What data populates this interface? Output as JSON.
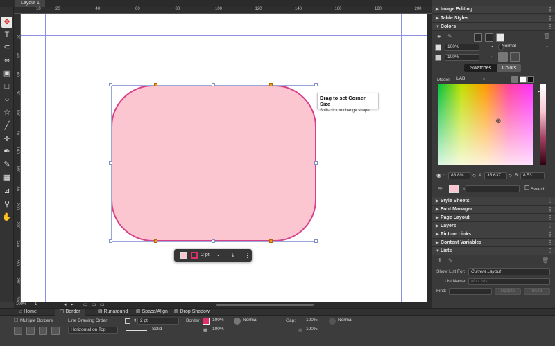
{
  "document": {
    "tab_label": "Layout 1"
  },
  "ruler": {
    "h_labels": [
      "10",
      "20",
      "40",
      "60",
      "80",
      "100",
      "120",
      "140",
      "160",
      "180",
      "200",
      "22"
    ],
    "v_labels": [
      "20",
      "40",
      "60",
      "80",
      "100",
      "120",
      "140",
      "160",
      "180",
      "200",
      "220",
      "240",
      "260",
      "280",
      "300"
    ]
  },
  "tools": [
    "move-icon",
    "text-icon",
    "text-link-icon",
    "link-icon",
    "picture-icon",
    "rectangle-icon",
    "oval-icon",
    "star-icon",
    "line-icon",
    "crosshair-icon",
    "pen-icon",
    "pencil-icon",
    "table-icon",
    "eyedropper-icon",
    "zoom-icon",
    "hand-icon"
  ],
  "tooltip": {
    "title": "Drag to set Corner Size",
    "subtitle": "Shift-click to change shape"
  },
  "floatbar": {
    "width": "2 pt"
  },
  "statusbar": {
    "zoom": "100%",
    "page": "1"
  },
  "panel": {
    "sections_top": [
      "Image Editing",
      "Table Styles",
      "Colors"
    ],
    "colors": {
      "opacity1": "100%",
      "blend": "Normal",
      "opacity2": "100%",
      "tab_swatches": "Swatches",
      "tab_colors": "Colors",
      "model_label": "Model:",
      "model_value": "LAB",
      "l_label": "L:",
      "l_value": "88.8%",
      "a_label": "A:",
      "a_value": "35.637",
      "b_label": "B:",
      "b_value": "8.531",
      "hash": "#",
      "swatch_label": "Swatch",
      "current_color": "#fcc6d1"
    },
    "sections_bottom": [
      "Style Sheets",
      "Font Manager",
      "Page Layout",
      "Layers",
      "Picture Links",
      "Content Variables",
      "Lists"
    ],
    "lists": {
      "show_list_label": "Show List For:",
      "show_list_value": "Current Layout",
      "list_name_label": "List Name:",
      "list_name_value": "No Lists",
      "find_label": "Find:",
      "update_label": "Update",
      "build_label": "Build"
    }
  },
  "bottom": {
    "tabs": [
      "Home",
      "Border",
      "Runaround",
      "Space/Align",
      "Drop Shadow"
    ],
    "multiple_borders": "Multiple Borders",
    "line_order_label": "Line Drawing Order:",
    "line_order_value": "Horizontal on Top",
    "width": "2 pt",
    "style": "Solid",
    "border_label": "Border:",
    "border_opacity": "100%",
    "border_opacity2": "100%",
    "border_blend": "Normal",
    "gap_label": "Gap:",
    "gap_opacity": "100%",
    "gap_opacity2": "100%",
    "gap_blend": "Normal",
    "border_color": "#e0306a"
  }
}
